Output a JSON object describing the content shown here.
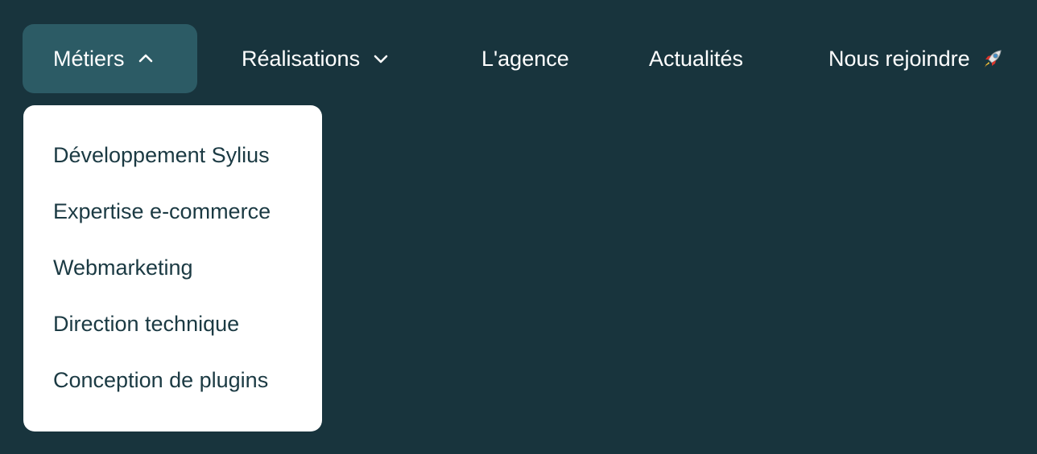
{
  "nav": {
    "items": [
      {
        "label": "Métiers"
      },
      {
        "label": "Réalisations"
      },
      {
        "label": "L'agence"
      },
      {
        "label": "Actualités"
      },
      {
        "label": "Nous rejoindre"
      }
    ],
    "active_index": 0
  },
  "dropdown": {
    "items": [
      {
        "label": "Développement Sylius"
      },
      {
        "label": "Expertise e-commerce"
      },
      {
        "label": "Webmarketing"
      },
      {
        "label": "Direction technique"
      },
      {
        "label": "Conception de plugins"
      }
    ]
  },
  "icons": {
    "metiers": "chevron-up-icon",
    "realisations": "chevron-down-icon",
    "rejoindre": "rocket-icon"
  },
  "colors": {
    "background": "#18343d",
    "active_tab": "#2c5b65",
    "dropdown_bg": "#ffffff",
    "dropdown_text": "#1b3a43",
    "nav_text": "#ffffff"
  }
}
